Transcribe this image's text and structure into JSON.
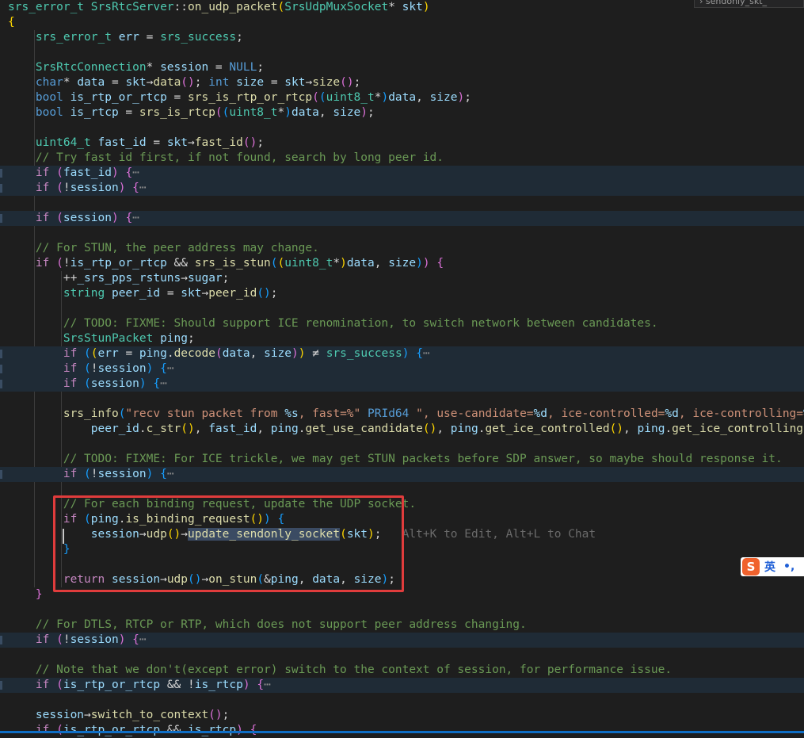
{
  "colors": {
    "background": "#1e1e1e",
    "keyword": "#c586c0",
    "type": "#4ec9b0",
    "function": "#dcdcaa",
    "variable": "#9cdcfe",
    "comment": "#6a9955",
    "string": "#ce9178",
    "punct": "#d4d4d4",
    "highlight_box": "#e03c3c"
  },
  "top_search": {
    "text": "› sendonly_skt_"
  },
  "inline_hint": "Alt+K to Edit, Alt+L to Chat",
  "ime": {
    "icon": "S",
    "lang": "英",
    "punct": "•,"
  },
  "code_lines": [
    "srs_error_t SrsRtcServer::on_udp_packet(SrsUdpMuxSocket* skt)",
    "{",
    "    srs_error_t err = srs_success;",
    "",
    "    SrsRtcConnection* session = NULL;",
    "    char* data = skt→data(); int size = skt→size();",
    "    bool is_rtp_or_rtcp = srs_is_rtp_or_rtcp((uint8_t*)data, size);",
    "    bool is_rtcp = srs_is_rtcp((uint8_t*)data, size);",
    "",
    "    uint64_t fast_id = skt→fast_id();",
    "    // Try fast id first, if not found, search by long peer id.",
    "    if (fast_id) {",
    "    if (!session) {",
    "",
    "    if (session) {",
    "",
    "    // For STUN, the peer address may change.",
    "    if (!is_rtp_or_rtcp && srs_is_stun((uint8_t*)data, size)) {",
    "        ++_srs_pps_rstuns→sugar;",
    "        string peer_id = skt→peer_id();",
    "",
    "        // TODO: FIXME: Should support ICE renomination, to switch network between candidates.",
    "        SrsStunPacket ping;",
    "        if ((err = ping.decode(data, size)) ≠ srs_success) {",
    "        if (!session) {",
    "        if (session) {",
    "",
    "        srs_info(\"recv stun packet from %s, fast=%\" PRId64 \", use-candidate=%d, ice-controlled=%d, ice-controlling=%d\",",
    "            peer_id.c_str(), fast_id, ping.get_use_candidate(), ping.get_ice_controlled(), ping.get_ice_controlling());",
    "",
    "        // TODO: FIXME: For ICE trickle, we may get STUN packets before SDP answer, so maybe should response it.",
    "        if (!session) {",
    "",
    "        // For each binding request, update the UDP socket.",
    "        if (ping.is_binding_request()) {",
    "            session→udp()→update_sendonly_socket(skt);",
    "        }",
    "",
    "        return session→udp()→on_stun(&ping, data, size);",
    "    }",
    "",
    "    // For DTLS, RTCP or RTP, which does not support peer address changing.",
    "    if (!session) {",
    "",
    "    // Note that we don't(except error) switch to the context of session, for performance issue.",
    "    if (is_rtp_or_rtcp && !is_rtcp) {",
    "",
    "    session→switch_to_context();",
    "    if (is_rtp_or_rtcp && is_rtcp) {"
  ]
}
